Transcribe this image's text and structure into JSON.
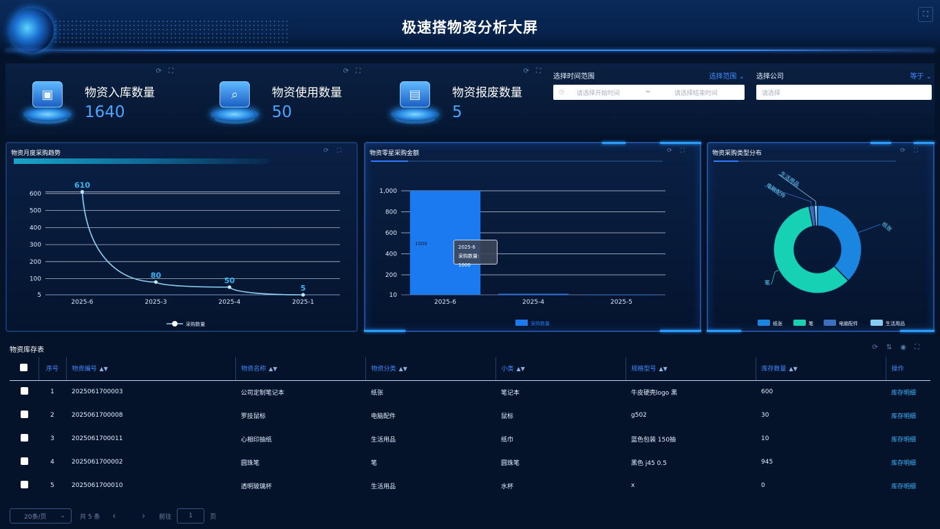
{
  "header": {
    "title": "极速搭物资分析大屏",
    "fullscreen_icon": "fullscreen-icon"
  },
  "stats": [
    {
      "label": "物资入库数量",
      "value": "1640",
      "icon": "warehouse-in-icon"
    },
    {
      "label": "物资使用数量",
      "value": "50",
      "icon": "usage-icon"
    },
    {
      "label": "物资报废数量",
      "value": "5",
      "icon": "scrap-icon"
    }
  ],
  "filters": {
    "time": {
      "label": "选择时间范围",
      "mode": "选择范围",
      "start_placeholder": "请选择开始时间",
      "separator": "~",
      "end_placeholder": "请选择结束时间"
    },
    "company": {
      "label": "选择公司",
      "mode": "等于",
      "placeholder": "请选择"
    }
  },
  "panels": {
    "trend_title": "物资月度采购趋势",
    "amount_title": "物资零星采购金额",
    "type_title": "物资采购类型分布"
  },
  "chart_data": [
    {
      "type": "line",
      "title": "物资月度采购趋势",
      "categories": [
        "2025-6",
        "2025-3",
        "2025-4",
        "2025-1"
      ],
      "series": [
        {
          "name": "采购数量",
          "values": [
            610,
            80,
            50,
            5
          ]
        }
      ],
      "yticks": [
        "5",
        "100",
        "200",
        "300",
        "400",
        "500",
        "600"
      ],
      "ylim": [
        5,
        620
      ],
      "grid": true,
      "legend": "bottom"
    },
    {
      "type": "bar",
      "title": "物资零星采购金额",
      "categories": [
        "2025-6",
        "2025-4",
        "2025-5"
      ],
      "series": [
        {
          "name": "采购数量",
          "values": [
            1000,
            20,
            10
          ]
        }
      ],
      "yticks": [
        "10",
        "200",
        "400",
        "600",
        "800",
        "1,000"
      ],
      "ylim": [
        10,
        1000
      ],
      "data_label": "1000",
      "tooltip": {
        "title": "2025-6",
        "text": "采购数量: 1000"
      },
      "grid": true,
      "legend": "bottom"
    },
    {
      "type": "pie",
      "title": "物资采购类型分布",
      "labels": [
        "纸张",
        "笔",
        "电脑配件",
        "生活用品"
      ],
      "values": [
        600,
        945,
        30,
        20
      ],
      "colors": [
        "#1a86e0",
        "#17d1b5",
        "#3c6fc0",
        "#86ccf2"
      ],
      "legend": "bottom"
    }
  ],
  "table": {
    "title": "物资库存表",
    "tool_icons": [
      "refresh-icon",
      "column-height-icon",
      "eye-icon",
      "fullscreen-icon"
    ],
    "headers": [
      "序号",
      "物资编号",
      "物资名称",
      "物资分类",
      "小类",
      "规格型号",
      "库存数量",
      "操作"
    ],
    "rows": [
      {
        "no": "1",
        "code": "2025061700003",
        "name": "公司定制笔记本",
        "category": "纸张",
        "sub": "笔记本",
        "spec": "牛皮硬壳logo 黑",
        "stock": "600",
        "op": "库存明细"
      },
      {
        "no": "2",
        "code": "2025061700008",
        "name": "罗技鼠标",
        "category": "电脑配件",
        "sub": "鼠标",
        "spec": "g502",
        "stock": "30",
        "op": "库存明细"
      },
      {
        "no": "3",
        "code": "2025061700011",
        "name": "心相印抽纸",
        "category": "生活用品",
        "sub": "纸巾",
        "spec": "蓝色包装 150抽",
        "stock": "10",
        "op": "库存明细"
      },
      {
        "no": "4",
        "code": "2025061700002",
        "name": "圆珠笔",
        "category": "笔",
        "sub": "圆珠笔",
        "spec": "黑色 j45 0.5",
        "stock": "945",
        "op": "库存明细"
      },
      {
        "no": "5",
        "code": "2025061700010",
        "name": "透明玻璃杯",
        "category": "生活用品",
        "sub": "水杯",
        "spec": "x",
        "stock": "0",
        "op": "库存明细"
      }
    ]
  },
  "pager": {
    "page_size": "20条/页",
    "total": "共 5 条",
    "prev": "‹",
    "next": "›",
    "goto": "前往",
    "page": "1",
    "page_unit": "页"
  }
}
